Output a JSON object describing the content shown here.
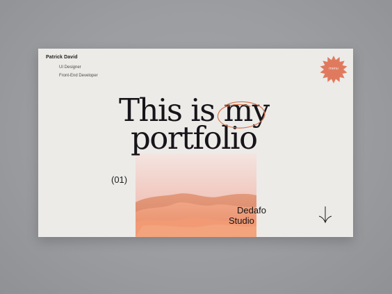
{
  "header": {
    "name": "Patrick David",
    "roles": [
      "UI Designer",
      "Front-End Developer"
    ]
  },
  "menu": {
    "label": "menu",
    "color": "#e07a5f"
  },
  "hero": {
    "line1": "This is my",
    "line2": "portfolio",
    "accent_color": "#d8734f"
  },
  "section": {
    "index": "(01)"
  },
  "studio": {
    "line1": "Dedafo",
    "line2": "Studio"
  },
  "icons": {
    "scroll": "arrow-down-icon",
    "menu": "starburst-badge-icon"
  }
}
